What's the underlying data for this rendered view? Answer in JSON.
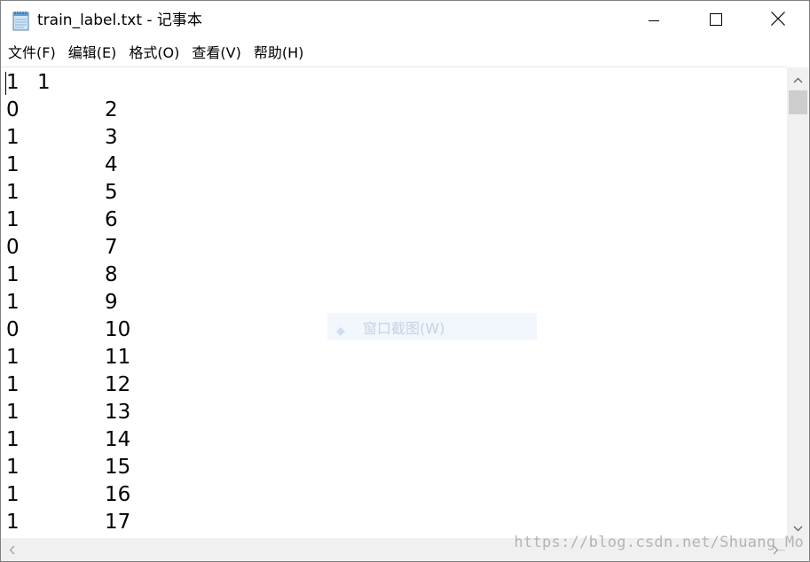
{
  "window": {
    "title": "train_label.txt - 记事本"
  },
  "menu": [
    {
      "label": "文件(F)"
    },
    {
      "label": "编辑(E)"
    },
    {
      "label": "格式(O)"
    },
    {
      "label": "查看(V)"
    },
    {
      "label": "帮助(H)"
    }
  ],
  "content": {
    "lines": [
      {
        "a": "1",
        "b": "1"
      },
      {
        "a": "0",
        "b": "2"
      },
      {
        "a": "1",
        "b": "3"
      },
      {
        "a": "1",
        "b": "4"
      },
      {
        "a": "1",
        "b": "5"
      },
      {
        "a": "1",
        "b": "6"
      },
      {
        "a": "0",
        "b": "7"
      },
      {
        "a": "1",
        "b": "8"
      },
      {
        "a": "1",
        "b": "9"
      },
      {
        "a": "0",
        "b": "10"
      },
      {
        "a": "1",
        "b": "11"
      },
      {
        "a": "1",
        "b": "12"
      },
      {
        "a": "1",
        "b": "13"
      },
      {
        "a": "1",
        "b": "14"
      },
      {
        "a": "1",
        "b": "15"
      },
      {
        "a": "1",
        "b": "16"
      },
      {
        "a": "1",
        "b": "17"
      }
    ]
  },
  "overlay": {
    "label": "窗口截图(W)"
  },
  "watermark": "https://blog.csdn.net/Shuang_Mo",
  "icons": {
    "app": "notepad-icon",
    "minimize": "minimize-icon",
    "maximize": "maximize-icon",
    "close": "close-icon",
    "scroll_up": "chevron-up-icon",
    "scroll_down": "chevron-down-icon",
    "scroll_left": "chevron-left-icon",
    "scroll_right": "chevron-right-icon"
  }
}
